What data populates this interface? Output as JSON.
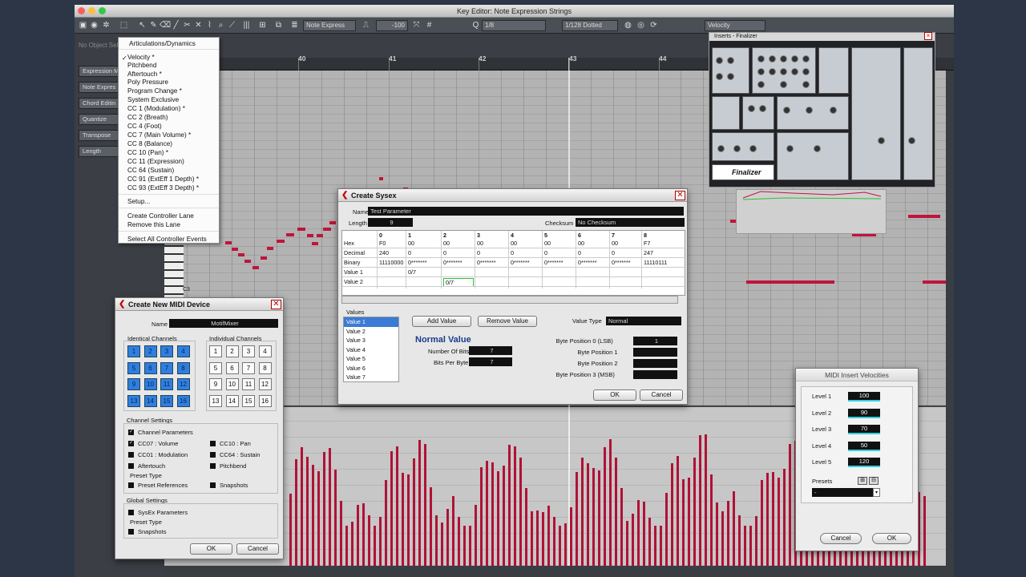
{
  "window": {
    "title": "Key Editor: Note Expression Strings"
  },
  "toolbar": {
    "note_expression": "Note Express",
    "transpose": "-100",
    "quantize": "1/8",
    "length": "1/128 Dotted",
    "controller": "Velocity"
  },
  "infoline": {
    "text": "No Object Sel"
  },
  "left_panel": {
    "items": [
      "Expression M",
      "Note Expres",
      "Chord Editin",
      "Quantize",
      "Transpose",
      "Length"
    ]
  },
  "ruler": {
    "marks": [
      "40",
      "41",
      "42",
      "43",
      "44"
    ]
  },
  "keyboard": {
    "c3_label": "C3"
  },
  "controller_menu": {
    "items": [
      "Articulations/Dynamics",
      "Velocity *",
      "Pitchbend",
      "Aftertouch *",
      "Poly Pressure",
      "Program Change *",
      "System Exclusive",
      "CC 1  (Modulation) *",
      "CC 2  (Breath)",
      "CC 4  (Foot)",
      "CC 7  (Main Volume) *",
      "CC 8  (Balance)",
      "CC 10  (Pan) *",
      "CC 11  (Expression)",
      "CC 64  (Sustain)",
      "CC 91  (ExtEff 1 Depth) *",
      "CC 93  (ExtEff 3 Depth) *",
      "Setup...",
      "Create Controller Lane",
      "Remove this Lane",
      "Select All Controller Events"
    ],
    "checked": "✓"
  },
  "sysex": {
    "title": "Create Sysex",
    "name_label": "Name",
    "name_value": "Test Parameter",
    "length_label": "Length",
    "length_value": "9",
    "checksum_label": "Checksum",
    "checksum_value": "No Checksum",
    "columns": [
      "0",
      "1",
      "2",
      "3",
      "4",
      "5",
      "6",
      "7",
      "8"
    ],
    "rows": [
      {
        "label": "Hex",
        "cells": [
          "F0",
          "00",
          "00",
          "00",
          "00",
          "00",
          "00",
          "00",
          "F7"
        ]
      },
      {
        "label": "Decimal",
        "cells": [
          "240",
          "0",
          "0",
          "0",
          "0",
          "0",
          "0",
          "0",
          "247"
        ]
      },
      {
        "label": "Binary",
        "cells": [
          "11110000",
          "0*******",
          "0*******",
          "0*******",
          "0*******",
          "0*******",
          "0*******",
          "0*******",
          "11110111"
        ]
      },
      {
        "label": "Value 1",
        "cells": [
          "",
          "0/7",
          "",
          "",
          "",
          "",
          "",
          "",
          ""
        ]
      },
      {
        "label": "Value 2",
        "cells": [
          "",
          "",
          "0/7",
          "",
          "",
          "",
          "",
          "",
          ""
        ]
      }
    ],
    "values_label": "Values",
    "values": [
      "Value 1",
      "Value 2",
      "Value 3",
      "Value 4",
      "Value 5",
      "Value 6",
      "Value 7"
    ],
    "add_value": "Add Value",
    "remove_value": "Remove Value",
    "value_type_label": "Value Type",
    "value_type": "Normal",
    "normal_value_title": "Normal Value",
    "bits_label": "Number Of Bits",
    "bits_value": "7",
    "bits_per_byte_label": "Bits Per Byte",
    "bits_per_byte_value": "7",
    "byte_positions": [
      {
        "label": "Byte Position 0 (LSB)",
        "value": "1"
      },
      {
        "label": "Byte Position 1",
        "value": ""
      },
      {
        "label": "Byte Position 2",
        "value": ""
      },
      {
        "label": "Byte Position 3 (MSB)",
        "value": ""
      }
    ],
    "ok": "OK",
    "cancel": "Cancel"
  },
  "midi_device": {
    "title": "Create New MIDI Device",
    "name_label": "Name",
    "name_value": "MotifMixer",
    "identical_label": "Identical Channels",
    "individual_label": "Individual Channels",
    "channels": [
      "1",
      "2",
      "3",
      "4",
      "5",
      "6",
      "7",
      "8",
      "9",
      "10",
      "11",
      "12",
      "13",
      "14",
      "15",
      "16"
    ],
    "channel_settings_label": "Channel Settings",
    "channel_options": [
      {
        "label": "Channel Parameters",
        "checked": "✓"
      },
      {
        "label": "CC07 : Volume",
        "checked": "✓"
      },
      {
        "label": "CC10 : Pan",
        "checked": ""
      },
      {
        "label": "CC01 : Modulation",
        "checked": ""
      },
      {
        "label": "CC64 : Sustain",
        "checked": ""
      },
      {
        "label": "Aftertouch",
        "checked": ""
      },
      {
        "label": "Pitchbend",
        "checked": ""
      }
    ],
    "preset_type_label": "Preset Type",
    "preset_references": "Preset References",
    "snapshots": "Snapshots",
    "global_settings_label": "Global Settings",
    "sysex_parameters": "SysEx Parameters",
    "preset_type2_label": "Preset Type",
    "snapshots2": "Snapshots",
    "ok": "OK",
    "cancel": "Cancel"
  },
  "velocities": {
    "title": "MIDI Insert Velocities",
    "levels": [
      {
        "label": "Level 1",
        "value": "100"
      },
      {
        "label": "Level 2",
        "value": "90"
      },
      {
        "label": "Level 3",
        "value": "70"
      },
      {
        "label": "Level 4",
        "value": "50"
      },
      {
        "label": "Level 5",
        "value": "120"
      }
    ],
    "presets_label": "Presets",
    "preset_value": "-",
    "cancel": "Cancel",
    "ok": "OK"
  },
  "plugin": {
    "title": "Inserts - Finalizer",
    "logo": "Finalizer"
  },
  "colors": {
    "accent": "#c0143c",
    "window_bg": "#3a3d42",
    "channel_blue": "#2f7fe0",
    "level_bar": "#2fd1e0"
  }
}
